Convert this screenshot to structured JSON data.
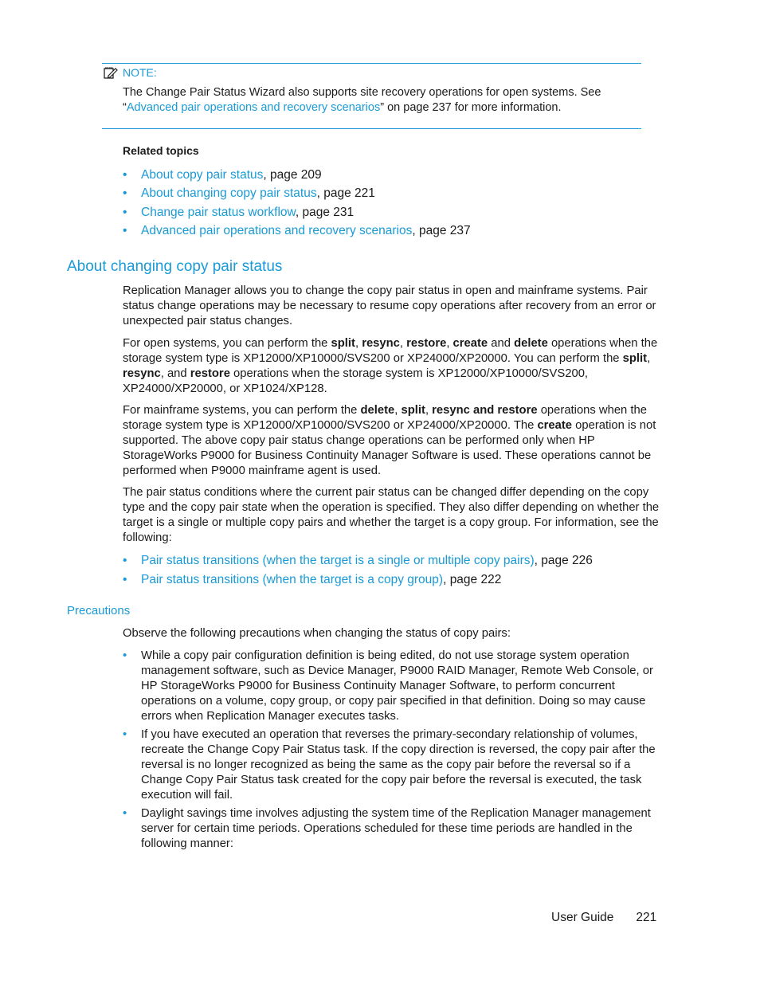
{
  "note": {
    "icon": "note-pencil-icon",
    "label": "NOTE:",
    "text_before": "The Change Pair Status Wizard also supports site recovery operations for open systems. See “",
    "link": "Advanced pair operations and recovery scenarios",
    "text_after": "” on page 237 for more information."
  },
  "related": {
    "title": "Related topics",
    "items": [
      {
        "link": "About copy pair status",
        "suffix": ", page 209"
      },
      {
        "link": "About changing copy pair status",
        "suffix": ", page 221"
      },
      {
        "link": "Change pair status workflow",
        "suffix": ", page 231"
      },
      {
        "link": "Advanced pair operations and recovery scenarios",
        "suffix": ", page 237"
      }
    ]
  },
  "section": {
    "heading": "About changing copy pair status",
    "p1": "Replication Manager allows you to change the copy pair status in open and mainframe systems. Pair status change operations may be necessary to resume copy operations after recovery from an error or unexpected pair status changes.",
    "p2": {
      "t1": "For open systems, you can perform the ",
      "b1": "split",
      "t2": ", ",
      "b2": "resync",
      "t3": ", ",
      "b3": "restore",
      "t4": ", ",
      "b4": "create",
      "t5": " and ",
      "b5": "delete",
      "t6": " operations when the storage system type is XP12000/XP10000/SVS200 or XP24000/XP20000. You can perform the ",
      "b6": "split",
      "t7": ", ",
      "b7": "resync",
      "t8": ", and ",
      "b8": "restore",
      "t9": " operations when the storage system is XP12000/XP10000/SVS200, XP24000/XP20000, or XP1024/XP128."
    },
    "p3": {
      "t1": "For mainframe systems, you can perform the ",
      "b1": "delete",
      "t2": ", ",
      "b2": "split",
      "t3": ", ",
      "b3": "resync and restore",
      "t4": " operations when the storage system type is XP12000/XP10000/SVS200 or XP24000/XP20000. The ",
      "b4": "create",
      "t5": " operation is not supported. The above copy pair status change operations can be performed only when HP StorageWorks P9000 for Business Continuity Manager Software is used. These operations cannot be performed when P9000 mainframe agent is used."
    },
    "p4": "The pair status conditions where the current pair status can be changed differ depending on the copy type and the copy pair state when the operation is specified. They also differ depending on whether the target is a single or multiple copy pairs and whether the target is a copy group. For information, see the following:",
    "transitions": [
      {
        "link": "Pair status transitions (when the target is a single or multiple copy pairs)",
        "suffix": ", page 226"
      },
      {
        "link": "Pair status transitions (when the target is a copy group)",
        "suffix": ", page 222"
      }
    ]
  },
  "precautions": {
    "heading": "Precautions",
    "intro": "Observe the following precautions when changing the status of copy pairs:",
    "items": [
      "While a copy pair configuration definition is being edited, do not use storage system operation management software, such as Device Manager, P9000 RAID Manager, Remote Web Console, or HP StorageWorks P9000 for Business Continuity Manager Software, to perform concurrent operations on a volume, copy group, or copy pair specified in that definition. Doing so may cause errors when Replication Manager executes tasks.",
      "If you have executed an operation that reverses the primary-secondary relationship of volumes, recreate the Change Copy Pair Status task. If the copy direction is reversed, the copy pair after the reversal is no longer recognized as being the same as the copy pair before the reversal so if a Change Copy Pair Status task created for the copy pair before the reversal is executed, the task execution will fail.",
      "Daylight savings time involves adjusting the system time of the Replication Manager management server for certain time periods. Operations scheduled for these time periods are handled in the following manner:"
    ]
  },
  "footer": {
    "guide": "User Guide",
    "page": "221"
  },
  "bullet_glyph": "•",
  "colors": {
    "accent": "#1a9ad6",
    "text": "#1a1a1a"
  }
}
